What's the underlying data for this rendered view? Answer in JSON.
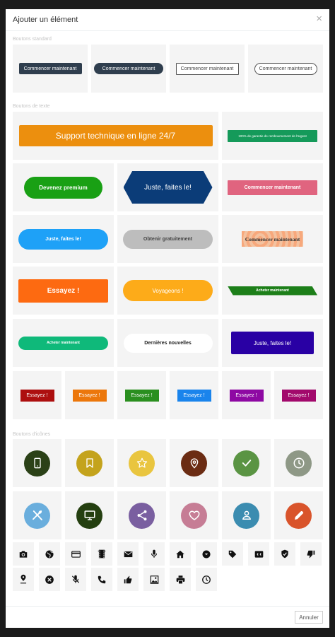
{
  "dialog": {
    "title": "Ajouter un élément",
    "cancel_label": "Annuler"
  },
  "sections": {
    "standard": "Boutons standard",
    "text": "Boutons de texte",
    "icons": "Boutons d'icônes"
  },
  "standard_buttons": [
    "Commencer maintenant",
    "Commencer maintenant",
    "Commencer maintenant",
    "Commencer maintenant"
  ],
  "text_buttons": {
    "support": "Support technique en ligne 24/7",
    "guarantee": "100% de garantie de remboursement de l'argent",
    "premium": "Devenez premium",
    "just_do_hex": "Juste, faites le!",
    "start_pink": "Commencer maintenant",
    "just_do_blue": "Juste, faites le!",
    "free": "Obtenir gratuitement",
    "start_pattern": "Commencer maintenant",
    "try_orange": "Essayez !",
    "travel": "Voyageons !",
    "buy_green": "Acheter maintenant",
    "buy_teal": "Acheter maintenant",
    "news": "Dernières nouvelles",
    "just_do_indigo": "Juste, faites le!",
    "try_small": [
      "Essayez !",
      "Essayez !",
      "Essayez !",
      "Essayez !",
      "Essayez !",
      "Essayez !"
    ]
  },
  "colors": {
    "dark": "#2f3e4e",
    "orange": "#ec8f0e",
    "green": "#159a5a",
    "green2": "#19a014",
    "navy": "#0b3c78",
    "pink": "#e0647f",
    "blue": "#1ea1f7",
    "grey": "#bdbdbd",
    "orange2": "#fd6a11",
    "yellow": "#fdab19",
    "olive": "#1d7f19",
    "teal": "#0fb97a",
    "indigo": "#2900a4",
    "red": "#ad0f0f",
    "small_orange": "#ec770b",
    "small_green": "#2a8f1f",
    "small_blue": "#1a84ec",
    "purple": "#8e09a3",
    "magenta": "#a2096c"
  },
  "icon_circles": [
    {
      "icon": "phone-icon",
      "color": "#2b4117"
    },
    {
      "icon": "bookmark-icon",
      "color": "#c4a31c"
    },
    {
      "icon": "star-icon",
      "color": "#e9c53f"
    },
    {
      "icon": "location-pin-icon",
      "color": "#6b2c13"
    },
    {
      "icon": "check-icon",
      "color": "#5a9443"
    },
    {
      "icon": "clock-icon",
      "color": "#8e9886"
    },
    {
      "icon": "utensils-icon",
      "color": "#6aaedd"
    },
    {
      "icon": "monitor-icon",
      "color": "#243f10"
    },
    {
      "icon": "share-icon",
      "color": "#7a5fa0"
    },
    {
      "icon": "heart-icon",
      "color": "#c67d95"
    },
    {
      "icon": "user-icon",
      "color": "#3b8cb0"
    },
    {
      "icon": "pencil-icon",
      "color": "#d9542b"
    }
  ],
  "icon_squares": [
    "camera-icon",
    "globe-icon",
    "credit-card-icon",
    "film-icon",
    "mail-icon",
    "microphone-icon",
    "home-icon",
    "chevron-circle-icon",
    "tag-icon",
    "cc-icon",
    "shield-check-icon",
    "thumbs-down-icon",
    "pin-icon",
    "close-circle-icon",
    "mic-off-icon",
    "phone-call-icon",
    "thumbs-up-icon",
    "image-icon",
    "print-icon",
    "clock-outline-icon"
  ]
}
